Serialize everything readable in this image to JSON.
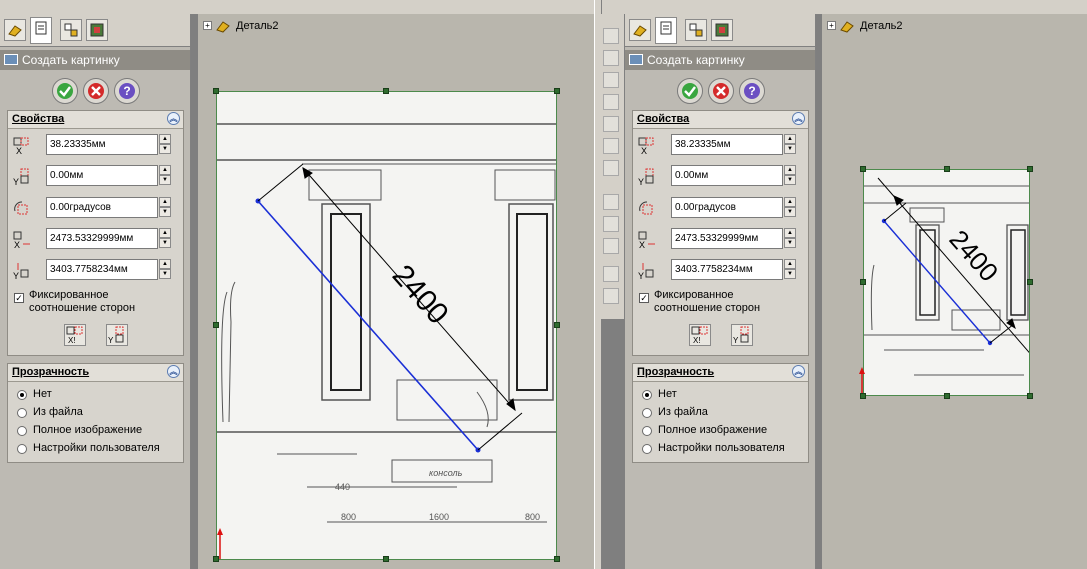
{
  "left": {
    "panel_title": "Создать картинку",
    "properties_header": "Свойства",
    "x_value": "38.23335мм",
    "y_value": "0.00мм",
    "angle_value": "0.00градусов",
    "width_value": "2473.53329999мм",
    "height_value": "3403.7758234мм",
    "lock_aspect_label_1": "Фиксированное",
    "lock_aspect_label_2": "соотношение сторон",
    "lock_aspect_checked": "✓",
    "transparency_header": "Прозрачность",
    "transparency_options": [
      "Нет",
      "Из файла",
      "Полное изображение",
      "Настройки пользователя"
    ],
    "tree_label": "Деталь2",
    "dimension": "2400"
  },
  "right": {
    "panel_title": "Создать картинку",
    "properties_header": "Свойства",
    "x_value": "38.23335мм",
    "y_value": "0.00мм",
    "angle_value": "0.00градусов",
    "width_value": "2473.53329999мм",
    "height_value": "3403.7758234мм",
    "lock_aspect_label_1": "Фиксированное",
    "lock_aspect_label_2": "соотношение сторон",
    "lock_aspect_checked": "✓",
    "transparency_header": "Прозрачность",
    "transparency_options": [
      "Нет",
      "Из файла",
      "Полное изображение",
      "Настройки пользователя"
    ],
    "tree_label": "Деталь2",
    "dimension": "2400"
  },
  "sketch_labels": {
    "console": "консоль",
    "d1": "440",
    "d2": "800",
    "d3": "1600",
    "d4": "800"
  },
  "colors": {
    "sketch_line": "#1a2fd6",
    "handle": "#2e6b2e",
    "panel_bg": "#bdbab3",
    "viewport_bg": "#b9b6ad"
  }
}
